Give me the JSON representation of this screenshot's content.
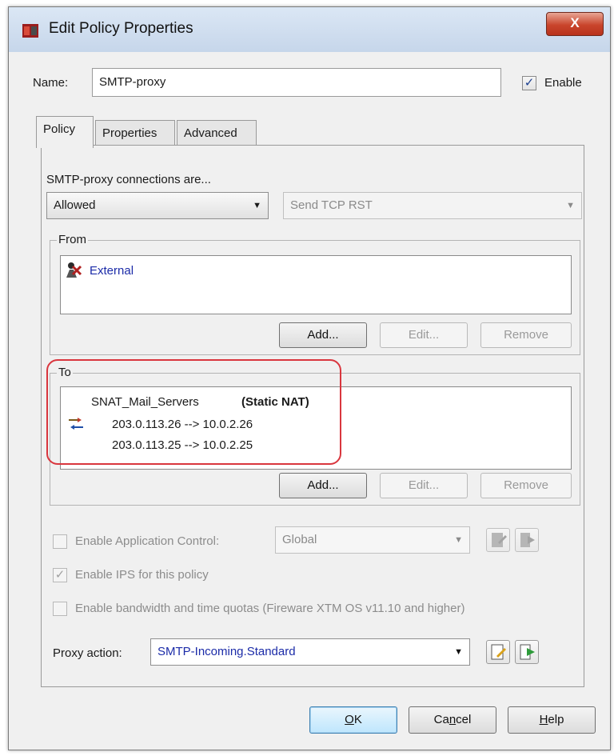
{
  "window": {
    "title": "Edit Policy Properties",
    "close_label": "X"
  },
  "name_field": {
    "label": "Name:",
    "value": "SMTP-proxy"
  },
  "enable": {
    "label": "Enable",
    "checked": true
  },
  "tabs": [
    {
      "label": "Policy",
      "active": true
    },
    {
      "label": "Properties",
      "active": false
    },
    {
      "label": "Advanced",
      "active": false
    }
  ],
  "policy": {
    "connections_label": "SMTP-proxy connections are...",
    "connection_action": "Allowed",
    "deny_action": "Send TCP RST"
  },
  "from": {
    "legend": "From",
    "items": [
      {
        "label": "External",
        "icon": "network-alias-icon"
      }
    ],
    "add": "Add...",
    "edit": "Edit...",
    "remove": "Remove"
  },
  "to": {
    "legend": "To",
    "item": {
      "name": "SNAT_Mail_Servers",
      "type": "(Static NAT)",
      "icon": "nat-arrows-icon",
      "mappings": [
        "203.0.113.26 --> 10.0.2.26",
        "203.0.113.25 --> 10.0.2.25"
      ]
    },
    "add": "Add...",
    "edit": "Edit...",
    "remove": "Remove"
  },
  "options": {
    "app_control": {
      "label": "Enable Application Control:",
      "checked": false,
      "value": "Global"
    },
    "ips": {
      "label": "Enable IPS for this policy",
      "checked": true
    },
    "quotas": {
      "label": "Enable bandwidth and time quotas (Fireware XTM OS v11.10 and higher)",
      "checked": false
    }
  },
  "proxy_action": {
    "label": "Proxy action:",
    "value": "SMTP-Incoming.Standard"
  },
  "footer": {
    "ok": {
      "mnemonic": "O",
      "rest": "K"
    },
    "cancel": {
      "pre": "Ca",
      "mnemonic": "n",
      "rest": "cel"
    },
    "help": {
      "mnemonic": "H",
      "rest": "elp"
    }
  },
  "colors": {
    "highlight": "#d9363e",
    "link_blue": "#1b2ba8"
  }
}
